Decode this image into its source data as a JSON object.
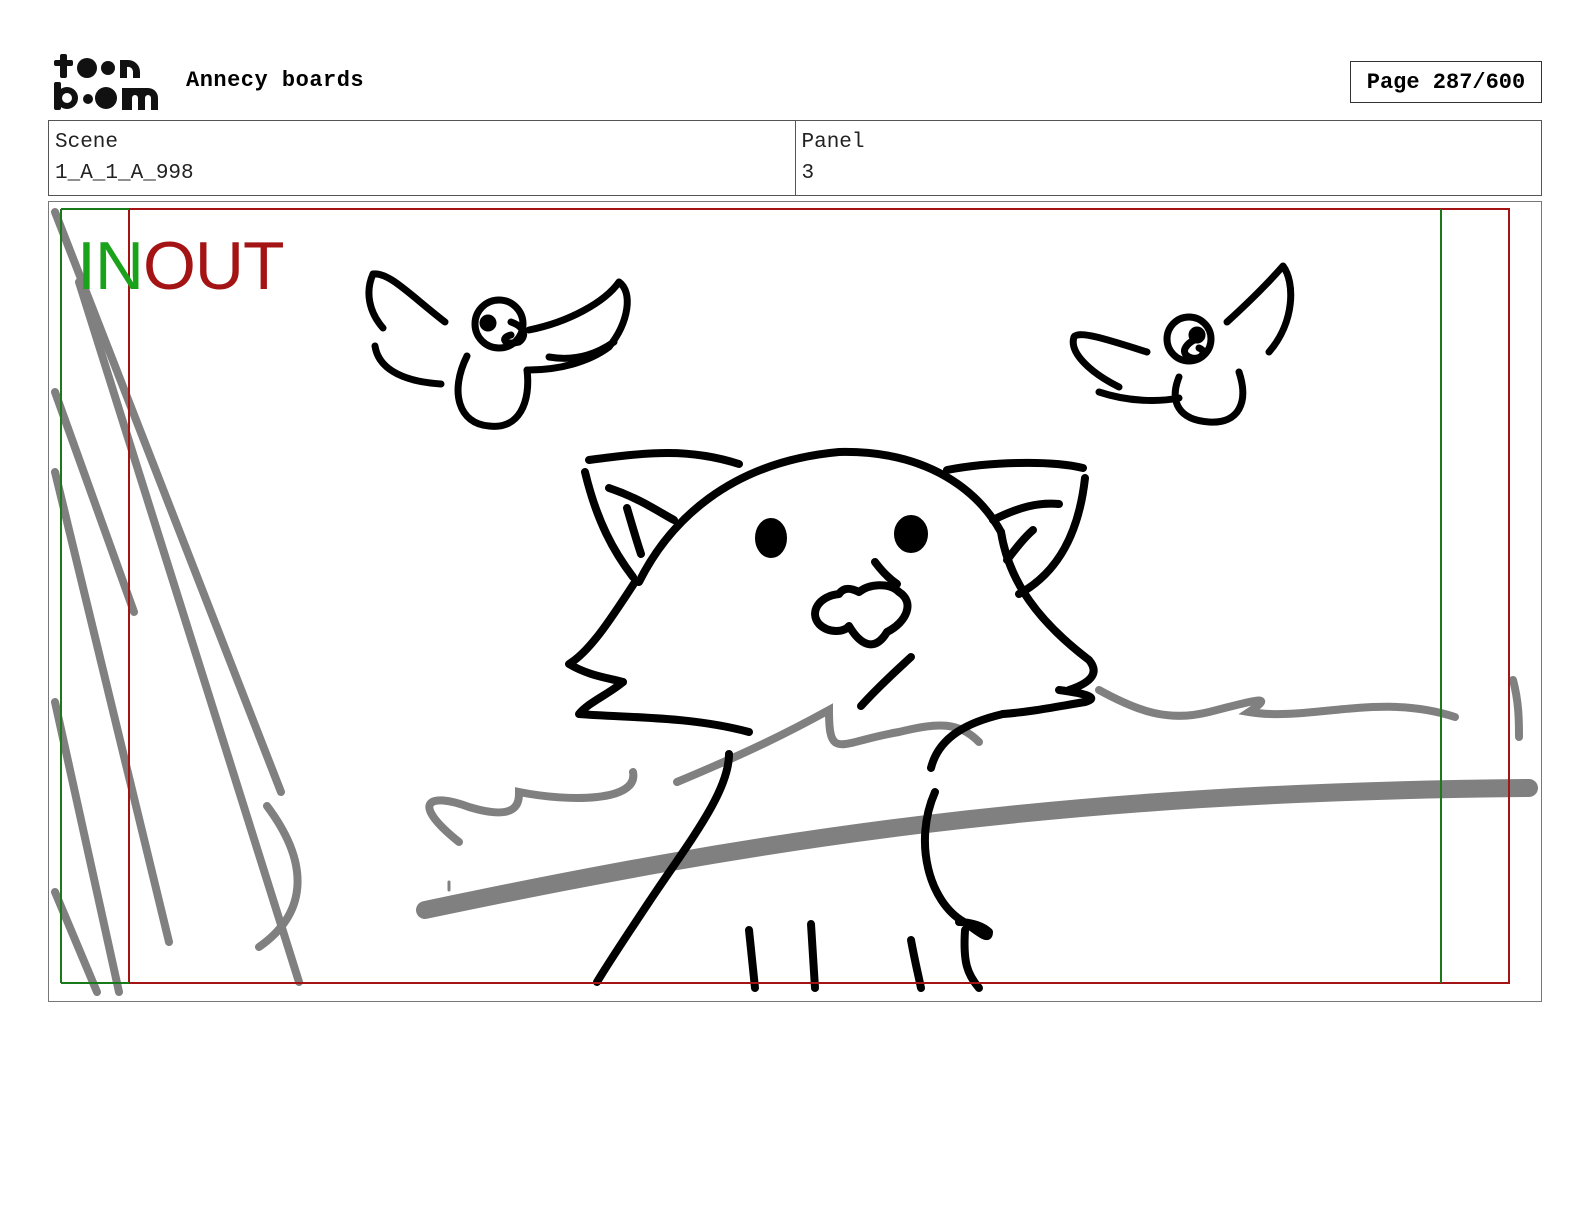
{
  "header": {
    "logo_text": "toon boom",
    "project_title": "Annecy boards",
    "page_indicator": "Page 287/600"
  },
  "info": {
    "scene_label": "Scene",
    "scene_value": "1_A_1_A_998",
    "panel_label": "Panel",
    "panel_value": "3"
  },
  "panel": {
    "in_label": "IN",
    "out_label": "OUT",
    "colors": {
      "in_marker": "#1aa31a",
      "out_marker": "#a51414",
      "sketch_line": "#000000",
      "background_sketch": "#808080"
    }
  }
}
